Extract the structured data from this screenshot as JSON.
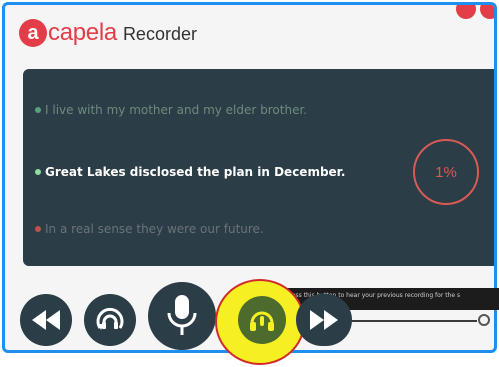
{
  "app": {
    "brand_letter": "a",
    "brand_rest": "capela",
    "subtitle": "Recorder"
  },
  "sentences": [
    "I live with my mother and my elder brother.",
    "Great Lakes disclosed the plan in December.",
    "In a real sense they were our future."
  ],
  "progress": {
    "label": "1%",
    "value": 1
  },
  "tooltip": {
    "text": "Press this button to hear your previous recording for the s"
  },
  "colors": {
    "frame": "#1e8ff0",
    "brand": "#e23d48",
    "panel": "#2b3d46",
    "highlight": "#f6ef21",
    "highlight_ring": "#d12a2a"
  },
  "icons": {
    "rewind": "rewind-icon",
    "replay": "replay-icon",
    "microphone": "microphone-icon",
    "listen": "headphones-icon",
    "forward": "fast-forward-icon",
    "settings": "settings-icon"
  }
}
